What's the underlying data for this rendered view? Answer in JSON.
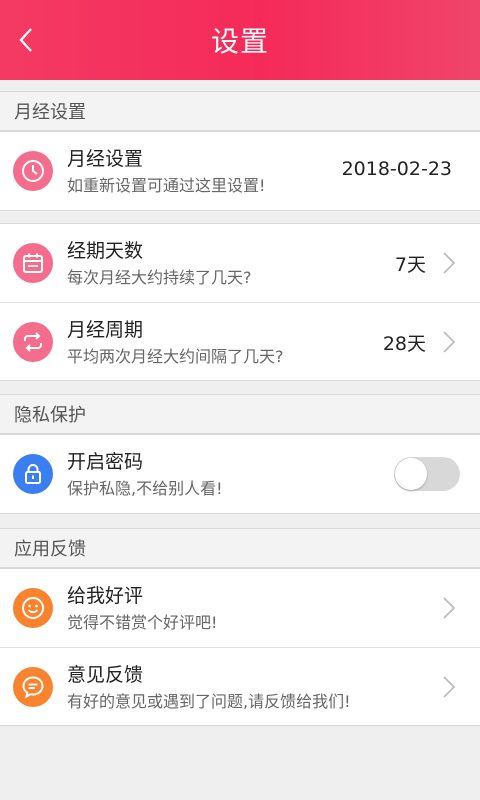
{
  "header": {
    "title": "设置"
  },
  "sections": {
    "period": {
      "header": "月经设置",
      "last_period": {
        "title": "月经设置",
        "subtitle": "如重新设置可通过这里设置!",
        "value": "2018-02-23"
      },
      "duration": {
        "title": "经期天数",
        "subtitle": "每次月经大约持续了几天?",
        "value": "7天"
      },
      "cycle": {
        "title": "月经周期",
        "subtitle": "平均两次月经大约间隔了几天?",
        "value": "28天"
      }
    },
    "privacy": {
      "header": "隐私保护",
      "password": {
        "title": "开启密码",
        "subtitle": "保护私隐,不给别人看!",
        "enabled": false
      }
    },
    "feedback": {
      "header": "应用反馈",
      "rate": {
        "title": "给我好评",
        "subtitle": "觉得不错赏个好评吧!"
      },
      "suggest": {
        "title": "意见反馈",
        "subtitle": "有好的意见或遇到了问题,请反馈给我们!"
      }
    }
  },
  "colors": {
    "header_bg": "#f52a59",
    "icon_pink": "#f56d8d",
    "icon_blue": "#3b7ef1",
    "icon_orange": "#f9832f"
  },
  "icons": {
    "back": "chevron-left-icon",
    "last_period": "clock-icon",
    "duration": "calendar-icon",
    "cycle": "repeat-icon",
    "password": "lock-icon",
    "rate": "smiley-icon",
    "suggest": "chat-bubble-icon",
    "row_arrow": "chevron-right-icon"
  }
}
